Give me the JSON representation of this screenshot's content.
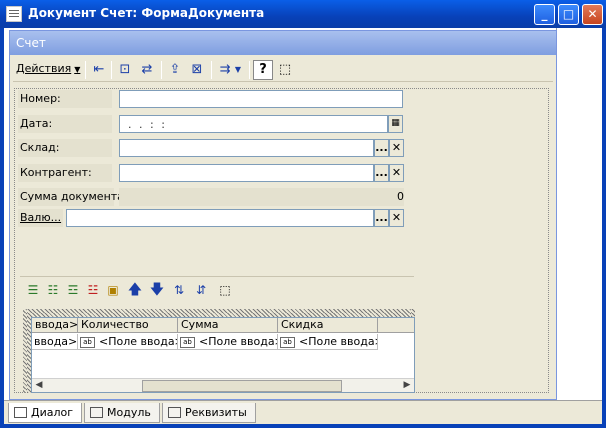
{
  "window": {
    "title": "Документ Счет: ФормаДокумента"
  },
  "form": {
    "title": "Счет",
    "toolbar": {
      "actions_label": "Действия"
    },
    "fields": {
      "number_label": "Номер:",
      "date_label": "Дата:",
      "date_value": ". .   : :",
      "warehouse_label": "Склад:",
      "counterparty_label": "Контрагент:",
      "sum_label": "Сумма документа:",
      "sum_value": "0",
      "currency_label": "Валю..."
    },
    "table": {
      "columns": [
        "ввода>",
        "Количество",
        "Сумма",
        "Скидка"
      ],
      "row": [
        "<Поле ввода>",
        "<Поле ввода>",
        "<Поле ввода>"
      ]
    },
    "button_labels": {
      "select": "...",
      "clear": "✕"
    }
  },
  "tabs": [
    "Диалог",
    "Модуль",
    "Реквизиты"
  ]
}
